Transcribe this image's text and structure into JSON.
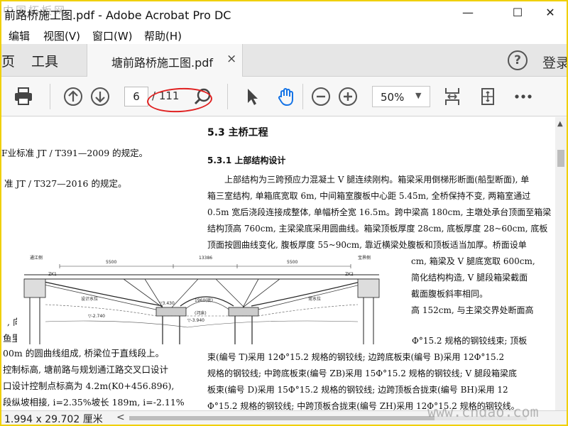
{
  "window": {
    "title": "前路桥施工图.pdf - Adobe Acrobat Pro DC",
    "minimize": "—",
    "maximize": "☐",
    "close": "✕",
    "watermark_top_left": "中国拓板网"
  },
  "menu": [
    "编辑",
    "视图(V)",
    "窗口(W)",
    "帮助(H)"
  ],
  "tabs": {
    "home_partial": "页",
    "tools": "工具",
    "document": "塘前路桥施工图.pdf",
    "close_symbol": "×",
    "help_symbol": "?",
    "login": "登录"
  },
  "toolbar": {
    "current_page": "6",
    "total_pages": "/ 111",
    "zoom": "50%",
    "annotation_color": "#e02020"
  },
  "document": {
    "left_lines": [
      "F业标准 JT / T391—2009 的规定。",
      "准 JT / T327—2016 的规定。",
      ", 向",
      "鱼里",
      "00m 的圆曲线组成, 桥梁位于直线段上。",
      "控制标高, 塘前路与规划通江路交叉口设计",
      "口设计控制点标高为 4.2m(K0+456.896),",
      "段纵坡相接, i=2.35%坡长 189m, i=-2.11%"
    ],
    "section_heading": "5.3 主桥工程",
    "subsection_heading": "5.3.1  上部结构设计",
    "body_lines": [
      "上部结构为三跨预应力混凝土 V 腿连续刚构。箱梁采用倒梯形断面(船型断面), 单",
      "箱三室结构, 单箱底宽取 6m, 中间箱室腹板中心距 5.45m, 全桥保持不变, 两箱室通过",
      "0.5m 宽后浇段连接成整体, 单幅桥全宽 16.5m。跨中梁高 180cm, 主墩处承台顶面至箱梁",
      "结构顶高 760cm, 主梁梁底采用圆曲线。箱梁顶板厚度 28cm, 底板厚度 28~60cm, 底板",
      "顶面按圆曲线变化, 腹板厚度 55~90cm, 靠近横梁处腹板和顶板适当加厚。桥面设单"
    ],
    "body_right_fragments": [
      "cm, 箱梁及 V 腿底宽取 600cm,",
      "简化结构构造, V 腿段箱梁截面",
      "截面腹板斜率相同。",
      "高 152cm, 与主梁交界处断面高"
    ],
    "body_lines_lower": [
      "Φ°15.2 规格的钢铰线束; 顶板",
      "束(编号 T)采用 12Φ°15.2 规格的钢铰线; 边跨底板束(编号 B)采用 12Φ°15.2",
      "规格的钢铰线; 中跨底板束(编号 ZB)采用 15Φ°15.2 规格的钢铰线; V 腿段箱梁底",
      "板束(编号 D)采用 15Φ°15.2 规格的钢铰线; 边跨顶板合拢束(编号 BH)采用 12",
      "Φ°15.2 规格的钢铰线; 中跨顶板合拢束(编号 ZH)采用 12Φ°15.2 规格的钢铰线。"
    ],
    "drawing_labels": {
      "dim_left": "5500",
      "dim_center": "13386",
      "dim_right": "5500",
      "top_left": "通江侧",
      "top_right": "宝界侧",
      "left_pier": "ZK1",
      "right_pier": "ZK2",
      "elev_a": "▽3.430",
      "elev_b": "▽-3.940",
      "elev_c": "▽-2.740",
      "note_a": "设计水位",
      "note_b": "常水位",
      "note_c": "(河床)",
      "note_d": "1960(底)"
    }
  },
  "statusbar": {
    "page_size": "1.994 x 29.702 厘米",
    "hscroll_left": "<"
  },
  "watermark_bottom_right": "www.cndao.com"
}
